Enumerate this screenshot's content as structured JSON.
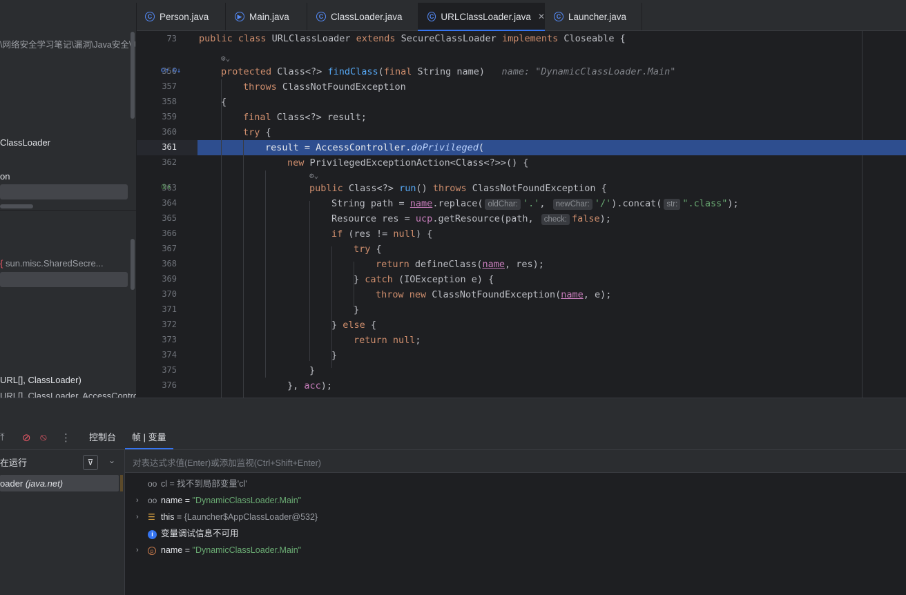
{
  "tabs": [
    {
      "label": "Person.java",
      "active": false
    },
    {
      "label": "Main.java",
      "active": false
    },
    {
      "label": "ClassLoader.java",
      "active": false
    },
    {
      "label": "URLClassLoader.java",
      "active": true
    },
    {
      "label": "Launcher.java",
      "active": false
    }
  ],
  "left_panel": {
    "path": "\\网络安全学习笔记\\漏洞\\Java安全\\J",
    "item_classloader": "ClassLoader",
    "item_on": "on",
    "item_sun": "sun.misc.SharedSecre...",
    "item_url1": "URL[], ClassLoader)",
    "item_url2": "URL[], ClassLoader, AccessControll"
  },
  "editor": {
    "lines": [
      {
        "num": "73"
      },
      {
        "num": "356"
      },
      {
        "num": "357"
      },
      {
        "num": "358"
      },
      {
        "num": "359"
      },
      {
        "num": "360"
      },
      {
        "num": "361"
      },
      {
        "num": "362"
      },
      {
        "num": "363"
      },
      {
        "num": "364"
      },
      {
        "num": "365"
      },
      {
        "num": "366"
      },
      {
        "num": "367"
      },
      {
        "num": "368"
      },
      {
        "num": "369"
      },
      {
        "num": "370"
      },
      {
        "num": "371"
      },
      {
        "num": "372"
      },
      {
        "num": "373"
      },
      {
        "num": "374"
      },
      {
        "num": "375"
      },
      {
        "num": "376"
      }
    ],
    "code": {
      "l73": {
        "kw1": "public class ",
        "cls": "URLClassLoader ",
        "kw2": "extends ",
        "sup": "SecureClassLoader ",
        "kw3": "implements ",
        "if": "Closeable {"
      },
      "l356": {
        "kw": "protected ",
        "t1": "Class<?> ",
        "fn": "findClass",
        "t2": "(",
        "kw2": "final ",
        "t3": "String name)",
        "inline": "name: \"DynamicClassLoader.Main\""
      },
      "l357": {
        "kw": "throws ",
        "t": "ClassNotFoundException"
      },
      "l358": {
        "t": "{"
      },
      "l359": {
        "kw": "final ",
        "t": "Class<?> result;"
      },
      "l360": {
        "kw": "try ",
        "t": "{"
      },
      "l361": {
        "t1": "result = AccessController.",
        "fn": "doPrivileged",
        "t2": "("
      },
      "l362": {
        "kw": "new ",
        "t": "PrivilegedExceptionAction<Class<?>>() {"
      },
      "l363": {
        "kw": "public ",
        "t1": "Class<?> ",
        "fn": "run",
        "t2": "() ",
        "kw2": "throws ",
        "t3": "ClassNotFoundException {"
      },
      "l364": {
        "t1": "String path = ",
        "p1": "name",
        "t2": ".replace(",
        "h1": "oldChar:",
        "s1": "'.'",
        "t3": ", ",
        "h2": "newChar:",
        "s2": "'/'",
        "t4": ").concat(",
        "h3": "str:",
        "s3": "\".class\"",
        "t5": ");"
      },
      "l365": {
        "t1": "Resource res = ",
        "f1": "ucp",
        "t2": ".getResource(path, ",
        "h1": "check:",
        "k1": "false",
        "t3": ");"
      },
      "l366": {
        "kw": "if ",
        "t1": "(res != ",
        "kw2": "null",
        "t2": ") {"
      },
      "l367": {
        "kw": "try ",
        "t": "{"
      },
      "l368": {
        "kw": "return ",
        "t1": "defineClass(",
        "p1": "name",
        "t2": ", res);"
      },
      "l369": {
        "t1": "} ",
        "kw": "catch ",
        "t2": "(IOException e) {"
      },
      "l370": {
        "kw": "throw new ",
        "t1": "ClassNotFoundException(",
        "p1": "name",
        "t2": ", e);"
      },
      "l371": {
        "t": "}"
      },
      "l372": {
        "t1": "} ",
        "kw": "else ",
        "t2": "{"
      },
      "l373": {
        "kw": "return ",
        "kw2": "null",
        "t": ";"
      },
      "l374": {
        "t": "}"
      },
      "l375": {
        "t": "}"
      },
      "l376": {
        "t1": "}, ",
        "f1": "acc",
        "t2": ");"
      }
    }
  },
  "debugger": {
    "tab_console": "控制台",
    "tab_frames": "帧 | 变量",
    "running_label": "在运行",
    "frame_label": "oader",
    "frame_pkg": "(java.net)",
    "eval_placeholder": "对表达式求值(Enter)或添加监视(Ctrl+Shift+Enter)",
    "variables": [
      {
        "name": "cl",
        "sep": " = ",
        "value": "找不到局部变量'cl'"
      },
      {
        "name": "name",
        "sep": " = ",
        "value": "\"DynamicClassLoader.Main\""
      },
      {
        "name": "this",
        "sep": " = ",
        "value": "{Launcher$AppClassLoader@532}"
      },
      {
        "name": "",
        "sep": "",
        "value": "变量调试信息不可用"
      },
      {
        "name": "name",
        "sep": " = ",
        "value": "\"DynamicClassLoader.Main\""
      }
    ]
  },
  "colors": {
    "accent": "#3574f0",
    "keyword": "#cf8e6d",
    "function": "#56a8f5",
    "string": "#6aab73",
    "field": "#c77dbb",
    "highlight": "#2e4e8f"
  }
}
